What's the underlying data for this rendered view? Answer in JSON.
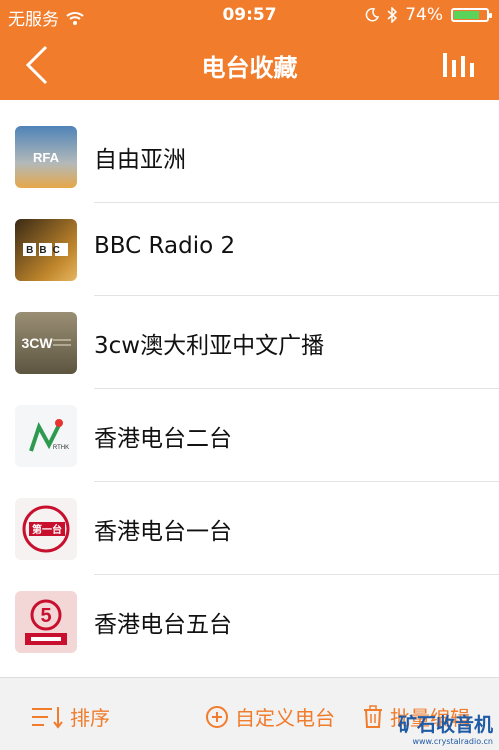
{
  "status": {
    "carrier": "无服务",
    "time": "09:57",
    "battery": "74%",
    "battery_level": 0.74
  },
  "nav": {
    "title": "电台收藏"
  },
  "stations": [
    {
      "name": "自由亚洲",
      "logo_text": "RFA"
    },
    {
      "name": "BBC Radio 2",
      "logo_text": "BBC"
    },
    {
      "name": "3cw澳大利亚中文广播",
      "logo_text": "3CW"
    },
    {
      "name": "香港电台二台",
      "logo_text": "RTHK"
    },
    {
      "name": "香港电台一台",
      "logo_text": "第一台"
    },
    {
      "name": "香港电台五台",
      "logo_text": "5"
    }
  ],
  "toolbar": {
    "sort_label": "排序",
    "custom_label": "自定义电台",
    "batch_label": "批量编辑"
  },
  "watermark": {
    "line1": "矿石收音机",
    "line2": "www.crystalradio.cn"
  },
  "colors": {
    "accent": "#f07c2c",
    "battery_fill": "#5bd35b"
  }
}
